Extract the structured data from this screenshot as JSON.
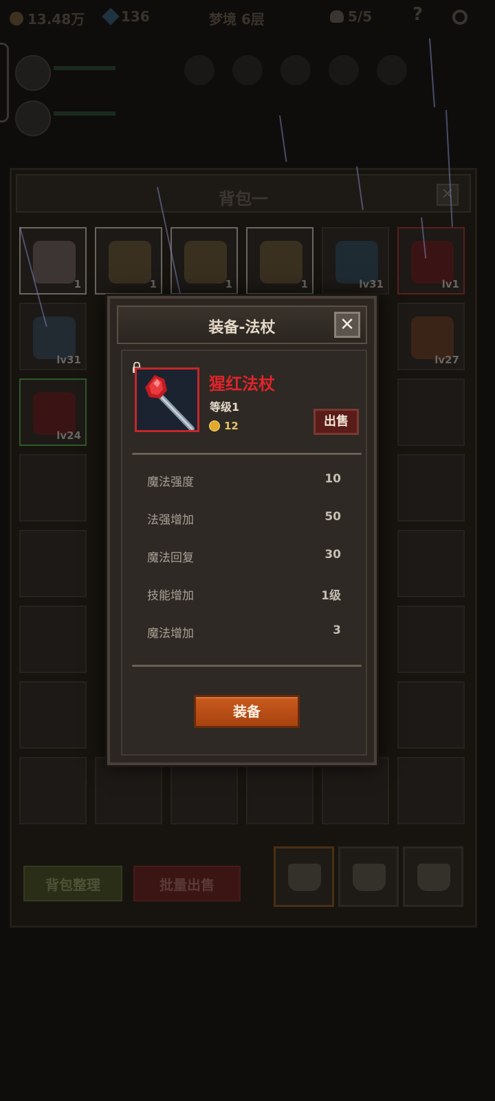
{
  "top_bar": {
    "gold": "13.48万",
    "gems": "136",
    "floor": "梦境 6层",
    "skull_count": "5/5",
    "help_icon": "question-mark-icon",
    "settings_icon": "gear-icon"
  },
  "backpack": {
    "title": "背包一",
    "close_icon": "close-icon",
    "row1": [
      {
        "icon": "cake-icon",
        "badge": "1",
        "border": "white"
      },
      {
        "icon": "beer-mug-icon",
        "badge": "1",
        "border": "white"
      },
      {
        "icon": "beer-mug-icon",
        "badge": "1",
        "border": "white"
      },
      {
        "icon": "beer-mug-icon",
        "badge": "1",
        "border": "white"
      },
      {
        "icon": "battle-axe-icon",
        "badge": "lv31",
        "border": "dark"
      },
      {
        "icon": "red-staff-icon",
        "badge": "lv1",
        "border": "red"
      }
    ],
    "row2": [
      {
        "icon": "knight-helmet-icon",
        "badge": "lv31"
      },
      {
        "icon": "pistol-icon",
        "badge": "lv27"
      }
    ],
    "row3": [
      {
        "icon": "red-armor-icon",
        "badge": "lv24"
      }
    ],
    "sort_label": "背包整理",
    "bulk_sell_label": "批量出售",
    "bag_tab_icon": "bag-icon"
  },
  "modal": {
    "title": "装备-法杖",
    "close_icon": "close-icon",
    "item": {
      "name": "猩红法杖",
      "level": "等级1",
      "price": "12",
      "icon": "red-staff-icon",
      "lock_icon": "lock-icon"
    },
    "sell_label": "出售",
    "stats": [
      {
        "name": "魔法强度",
        "value": "10"
      },
      {
        "name": "法强增加",
        "value": "50"
      },
      {
        "name": "魔法回复",
        "value": "30"
      },
      {
        "name": "技能增加",
        "value": "1级"
      },
      {
        "name": "魔法增加",
        "value": "3"
      }
    ],
    "equip_label": "装备"
  },
  "colors": {
    "item_name_red": "#e0242a",
    "equip_orange": "#c95a1f",
    "sell_dark_red": "#5a1c19",
    "gold": "#e3a92a"
  }
}
